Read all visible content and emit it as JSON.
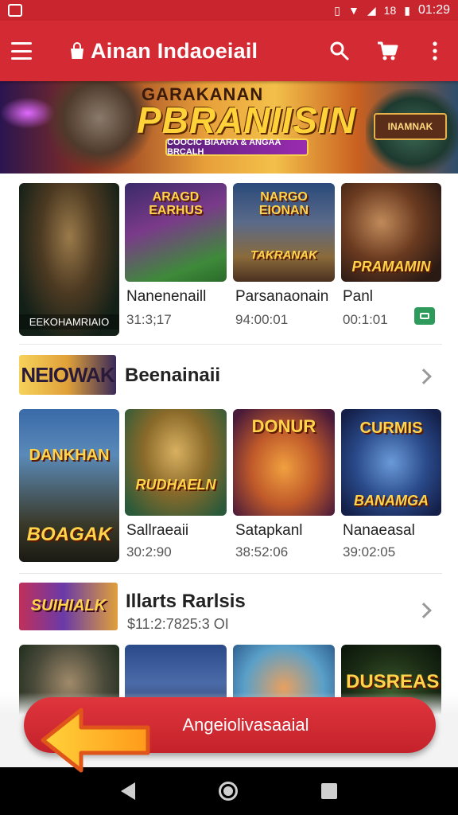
{
  "status_bar": {
    "time": "01:29",
    "signal_text": "18"
  },
  "app_bar": {
    "title": "Ainan Indaoeiail"
  },
  "hero": {
    "kicker": "GARAKANAN",
    "title": "PBRANIISIN",
    "ribbon": "COOCIC BIAARA & ANGAA BRCALH",
    "badge": "INAMNAK"
  },
  "top_row": {
    "featured_tile_caption": "EEKOHAMRIAIO",
    "games": [
      {
        "tile_text": "ARAGD EARHUS",
        "name": "Nanenenaill",
        "meta": "31:3;17"
      },
      {
        "tile_text": "NARGO EIONAN",
        "tile_bottom": "TAKRANAK",
        "name": "Parsanaonain",
        "meta": "94:00:01"
      },
      {
        "tile_text": "PRAMAMIN",
        "name": "Panl",
        "meta": "00:1:01"
      }
    ]
  },
  "section1": {
    "thumb_text": "NEIOWAK",
    "title": "Beenainaii"
  },
  "middle_row": {
    "games": [
      {
        "tile_top": "DANKHAN",
        "tile_text": "BOAGAK",
        "name": "",
        "meta": ""
      },
      {
        "tile_text": "RUDHAELN",
        "name": "Sallraeaii",
        "meta": "30:2:90"
      },
      {
        "tile_top": "DONUR",
        "name": "Satapkanl",
        "meta": "38:52:06"
      },
      {
        "tile_top": "CURMIS",
        "tile_text": "BANAMGA",
        "name": "Nanaeasal",
        "meta": "39:02:05"
      }
    ]
  },
  "section2": {
    "thumb_text": "SUIHIALK",
    "title": "Illarts Rarlsis",
    "subtitle": "$11:2:7825:3 OI"
  },
  "bottom_row": {
    "games": [
      {
        "tile_text": ""
      },
      {
        "tile_text": ""
      },
      {
        "tile_text": ""
      },
      {
        "tile_text": "DUSREAS"
      }
    ]
  },
  "cta": {
    "label": "Angeiolivasaaial"
  },
  "colors": {
    "primary": "#d42a33",
    "install": "#2e9a5c"
  }
}
